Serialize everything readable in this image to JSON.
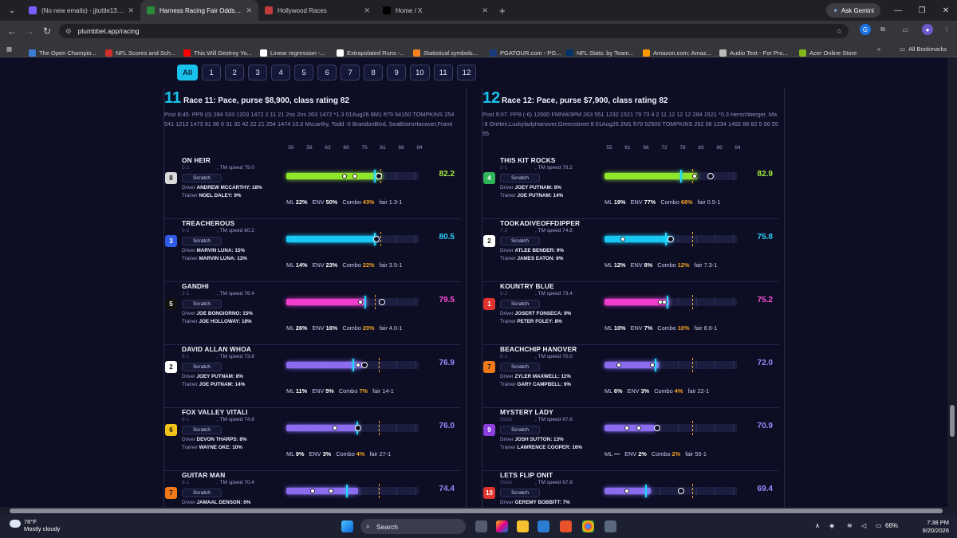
{
  "browser": {
    "tabs": [
      {
        "title": "(No new emails) - jjtuttle131@",
        "active": false,
        "fav_color": "#7b5cff"
      },
      {
        "title": "Harness Racing Fair Odds & Tr",
        "active": true,
        "fav_color": "#2a8a3a"
      },
      {
        "title": "Hollywood Races",
        "active": false,
        "fav_color": "#c23b3b"
      },
      {
        "title": "Home / X",
        "active": false,
        "fav_color": "#000000"
      }
    ],
    "new_tab": "+",
    "gemini_label": "Ask Gemini",
    "url": "plumbbet.app/racing",
    "bookmarks": [
      {
        "label": "The Open Champio...",
        "color": "#3a7bd5"
      },
      {
        "label": "NFL Scores and Sch...",
        "color": "#d0312d"
      },
      {
        "label": "This Will Destroy Yo...",
        "color": "#ff0000"
      },
      {
        "label": "Linear regression -...",
        "color": "#ffffff"
      },
      {
        "label": "Extrapolated Runs -...",
        "color": "#ffffff"
      },
      {
        "label": "Statistical symbols...",
        "color": "#f58220"
      },
      {
        "label": "PGATOUR.com - PG...",
        "color": "#1a3a7a"
      },
      {
        "label": "NFL Stats: by Team...",
        "color": "#013369"
      },
      {
        "label": "Amazon.com: Amaz...",
        "color": "#ff9900"
      },
      {
        "label": "Audio Text - For Pro...",
        "color": "#bbbbbb"
      },
      {
        "label": "Acer Online Store",
        "color": "#83b81a"
      }
    ],
    "all_bookmarks": "All Bookmarks"
  },
  "filters": [
    "All",
    "1",
    "2",
    "3",
    "4",
    "5",
    "6",
    "7",
    "8",
    "9",
    "10",
    "11",
    "12"
  ],
  "active_filter": "All",
  "races": [
    {
      "number": "11",
      "title": "Race 11: Pace, purse $8,900, class rating 82",
      "post": "Post 8:45. PP9 (0) 284 533 1203 1472 2 11 21 2ns 2ns 263 1472 *1.3 01Aug26 8M1 ft79 54150 TOMPKINS 254 541 1213 1473 91 96 6 31 32 42 22 21 254 1474 10.0 Mccarthy, Todd -5 BrandonBlvd, SeaBistroHanover,Franti",
      "ticks": [
        "50",
        "56",
        "63",
        "69",
        "75",
        "81",
        "88",
        "94"
      ],
      "horses": [
        {
          "name": "ON HEIR",
          "odds": "5-2",
          "speed": ", TM speed 79.0",
          "pp": "8",
          "pp_bg": "#d9d9d9",
          "pp_fg": "#111",
          "driver": "ANDREW MCCARTHY: 18%",
          "trainer": "NOEL DALEY: 9%",
          "score": "82.2",
          "score_color": "#a6f03a",
          "fill_color": "#8fe62a",
          "fill": 0.72,
          "dots": [
            0.44,
            0.52
          ],
          "open": [
            0.7
          ],
          "cyan": 0.66,
          "dash": 0.71,
          "ml": "22%",
          "env": "50%",
          "combo": "43%",
          "fair": "fair 1.3-1"
        },
        {
          "name": "TREACHEROUS",
          "odds": "9-2",
          "speed": ", TM speed 80.2",
          "pp": "3",
          "pp_bg": "#2f5be6",
          "pp_fg": "#fff",
          "driver": "MARVIN LUNA: 15%",
          "trainer": "MARVIN LUNA: 13%",
          "score": "80.5",
          "score_color": "#2ad4ff",
          "fill_color": "#18c8f2",
          "fill": 0.68,
          "dots": [],
          "open": [
            0.68
          ],
          "cyan": 0.66,
          "dash": 0.71,
          "ml": "14%",
          "env": "23%",
          "combo": "22%",
          "fair": "fair 3.5-1"
        },
        {
          "name": "GANDHI",
          "odds": "2-1",
          "speed": ", TM speed 76.4",
          "pp": "5",
          "pp_bg": "#111",
          "pp_fg": "#fff",
          "driver": "JOE BONGIORNO: 15%",
          "trainer": "JOE HOLLOWAY: 18%",
          "score": "79.5",
          "score_color": "#ff4fd8",
          "fill_color": "#f23ccf",
          "fill": 0.6,
          "dots": [
            0.56
          ],
          "open": [
            0.72
          ],
          "cyan": 0.59,
          "dash": 0.67,
          "ml": "26%",
          "env": "16%",
          "combo": "20%",
          "fair": "fair 4.0-1"
        },
        {
          "name": "DAVID ALLAN WHOA",
          "odds": "8-1",
          "speed": ", TM speed 73.8",
          "pp": "2",
          "pp_bg": "#ffffff",
          "pp_fg": "#111",
          "driver": "JOEY PUTNAM: 8%",
          "trainer": "JOE PUTNAM: 14%",
          "score": "76.9",
          "score_color": "#9b8cff",
          "fill_color": "#8b6cf0",
          "fill": 0.57,
          "dots": [
            0.54
          ],
          "open": [
            0.59
          ],
          "cyan": 0.5,
          "dash": 0.7,
          "ml": "11%",
          "env": "5%",
          "combo": "7%",
          "fair": "fair 14-1"
        },
        {
          "name": "FOX VALLEY VITALI",
          "odds": "8-1",
          "speed": ", TM speed 74.8",
          "pp": "6",
          "pp_bg": "#f0c21a",
          "pp_fg": "#111",
          "driver": "DEVON THARPS: 8%",
          "trainer": "WAYNE OKE: 10%",
          "score": "76.0",
          "score_color": "#9b8cff",
          "fill_color": "#8b6cf0",
          "fill": 0.55,
          "dots": [
            0.37
          ],
          "open": [
            0.54
          ],
          "cyan": 0.53,
          "dash": 0.7,
          "ml": "9%",
          "env": "3%",
          "combo": "4%",
          "fair": "fair 27-1"
        },
        {
          "name": "GUITAR MAN",
          "odds": "8-1",
          "speed": ", TM speed 70.4",
          "pp": "7",
          "pp_bg": "#f07a1a",
          "pp_fg": "#111",
          "driver": "JAMAAL DENSON: 6%",
          "trainer": "",
          "score": "74.4",
          "score_color": "#9b8cff",
          "fill_color": "#8b6cf0",
          "fill": 0.54,
          "dots": [
            0.2,
            0.34
          ],
          "open": [],
          "cyan": 0.45,
          "dash": 0.7,
          "ml": "",
          "env": "",
          "combo": "",
          "fair": ""
        }
      ]
    },
    {
      "number": "12",
      "title": "Race 12: Pace, purse $7,900, class rating 82",
      "post": "Post 9:07. PP8 (-6) 12000 FMNW3PM 263 551 1232 1521 79 73 4 2 11 12 12 12 284 1521 *0.3 Herschberger, Ma -9 OnHeir,LuckyladyHanover,Greenstreet 8 01Aug26 2M1 ft79 52500 TOMPKINS 262 56 1234 1492 86 82 5 56 55 55",
      "ticks": [
        "55",
        "61",
        "66",
        "72",
        "78",
        "83",
        "89",
        "94"
      ],
      "horses": [
        {
          "name": "THIS KIT ROCKS",
          "odds": "2-1",
          "speed": ", TM speed 78.2",
          "pp": "4",
          "pp_bg": "#2fb55a",
          "pp_fg": "#fff",
          "driver": "JOEY PUTNAM: 8%",
          "trainer": "JOE PUTNAM: 14%",
          "score": "82.9",
          "score_color": "#a6f03a",
          "fill_color": "#8fe62a",
          "fill": 0.7,
          "dots": [
            0.68
          ],
          "open": [
            0.8
          ],
          "cyan": 0.57,
          "dash": 0.66,
          "ml": "19%",
          "env": "77%",
          "combo": "66%",
          "fair": "fair 0.5-1"
        },
        {
          "name": "TOOKADIVEOFFDIPPER",
          "odds": "7-2",
          "speed": ", TM speed 74.8",
          "pp": "2",
          "pp_bg": "#ffffff",
          "pp_fg": "#111",
          "driver": "ATLEE BENDER: 9%",
          "trainer": "JAMES EATON: 8%",
          "score": "75.8",
          "score_color": "#2ad4ff",
          "fill_color": "#18c8f2",
          "fill": 0.51,
          "dots": [
            0.14
          ],
          "open": [
            0.5
          ],
          "cyan": 0.46,
          "dash": 0.66,
          "ml": "12%",
          "env": "8%",
          "combo": "12%",
          "fair": "fair 7.3-1"
        },
        {
          "name": "KOUNTRY BLUE",
          "odds": "9-2",
          "speed": ", TM speed 73.4",
          "pp": "1",
          "pp_bg": "#e0332e",
          "pp_fg": "#fff",
          "driver": "JOSERT FONSECA: 9%",
          "trainer": "PETER FOLEY: 8%",
          "score": "75.2",
          "score_color": "#ff4fd8",
          "fill_color": "#f23ccf",
          "fill": 0.49,
          "dots": [
            0.42,
            0.45
          ],
          "open": [],
          "cyan": 0.47,
          "dash": 0.66,
          "ml": "10%",
          "env": "7%",
          "combo": "10%",
          "fair": "fair 8.6-1"
        },
        {
          "name": "BEACHCHIP HANOVER",
          "odds": "8-1",
          "speed": ", TM speed 70.0",
          "pp": "7",
          "pp_bg": "#f07a1a",
          "pp_fg": "#111",
          "driver": "ZYLER MAXWELL: 11%",
          "trainer": "GARY CAMPBELL: 9%",
          "score": "72.0",
          "score_color": "#9b8cff",
          "fill_color": "#8b6cf0",
          "fill": 0.41,
          "dots": [
            0.11,
            0.36
          ],
          "open": [],
          "cyan": 0.38,
          "dash": 0.66,
          "ml": "6%",
          "env": "3%",
          "combo": "4%",
          "fair": "fair 22-1"
        },
        {
          "name": "MYSTERY LADY",
          "odds": "Odds",
          "speed": ", TM speed 67.6",
          "pp": "9",
          "pp_bg": "#8b3fe0",
          "pp_fg": "#fff",
          "driver": "JOSH SUTTON: 13%",
          "trainer": "LAWRENCE COOPER: 16%",
          "score": "70.9",
          "score_color": "#9b8cff",
          "fill_color": "#8b6cf0",
          "fill": 0.38,
          "dots": [
            0.17,
            0.26
          ],
          "open": [
            0.4
          ],
          "cyan": 0.0,
          "dash": 0.66,
          "ml": "—",
          "env": "2%",
          "combo": "2%",
          "fair": "fair 55-1"
        },
        {
          "name": "LETS FLIP ONIT",
          "odds": "Odds",
          "speed": ", TM speed 67.8",
          "pp": "10",
          "pp_bg": "#e0332e",
          "pp_fg": "#fff",
          "driver": "GEREMY BOBBITT: 7%",
          "trainer": "",
          "score": "69.4",
          "score_color": "#9b8cff",
          "fill_color": "#8b6cf0",
          "fill": 0.35,
          "dots": [
            0.17
          ],
          "open": [
            0.58
          ],
          "cyan": 0.31,
          "dash": 0.66,
          "ml": "",
          "env": "",
          "combo": "",
          "fair": ""
        }
      ]
    }
  ],
  "labels": {
    "scratch": "Scratch",
    "driver": "Driver",
    "trainer": "Trainer",
    "ml": "ML",
    "env": "ENV",
    "combo": "Combo"
  },
  "taskbar": {
    "temp": "78°F",
    "condition": "Mostly cloudy",
    "search": "Search",
    "battery": "66%",
    "time": "7:38 PM",
    "date": "9/20/2026"
  }
}
